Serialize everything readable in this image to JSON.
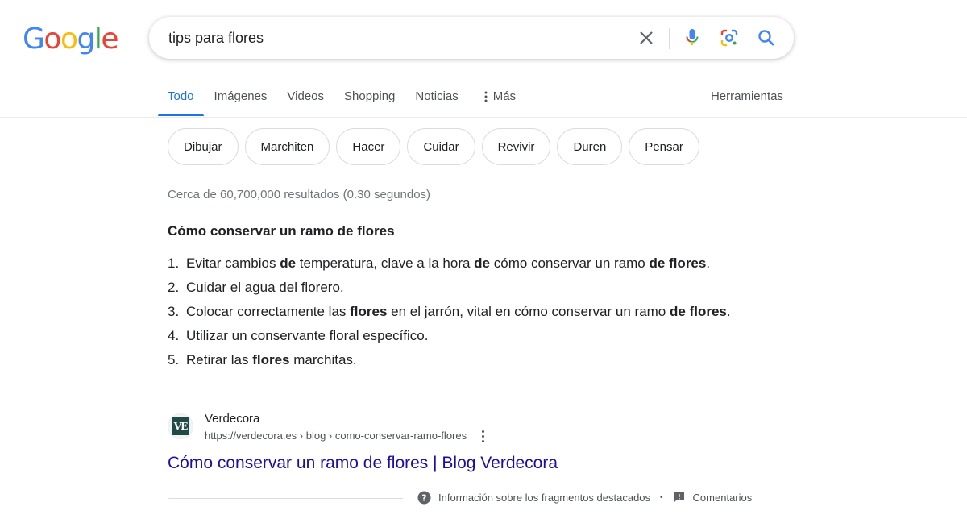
{
  "logo": {
    "text": "Google"
  },
  "search": {
    "value": "tips para flores",
    "clear_icon": "close-icon",
    "voice_icon": "microphone-icon",
    "lens_icon": "lens-icon",
    "search_icon": "search-icon"
  },
  "tabs": [
    {
      "label": "Todo",
      "active": true
    },
    {
      "label": "Imágenes"
    },
    {
      "label": "Videos"
    },
    {
      "label": "Shopping"
    },
    {
      "label": "Noticias"
    },
    {
      "label": "Más"
    }
  ],
  "tools_label": "Herramientas",
  "chips": [
    "Dibujar",
    "Marchiten",
    "Hacer",
    "Cuidar",
    "Revivir",
    "Duren",
    "Pensar"
  ],
  "stats": "Cerca de 60,700,000 resultados (0.30 segundos)",
  "snippet": {
    "title": "Cómo conservar un ramo de flores",
    "items": [
      {
        "num": "1.",
        "parts": [
          {
            "t": "Evitar cambios "
          },
          {
            "t": "de",
            "b": true
          },
          {
            "t": " temperatura, clave a la hora "
          },
          {
            "t": "de",
            "b": true
          },
          {
            "t": " cómo conservar un ramo "
          },
          {
            "t": "de flores",
            "b": true
          },
          {
            "t": "."
          }
        ]
      },
      {
        "num": "2.",
        "parts": [
          {
            "t": "Cuidar el agua del florero."
          }
        ]
      },
      {
        "num": "3.",
        "parts": [
          {
            "t": "Colocar correctamente las "
          },
          {
            "t": "flores",
            "b": true
          },
          {
            "t": " en el jarrón, vital en cómo conservar un ramo "
          },
          {
            "t": "de flores",
            "b": true
          },
          {
            "t": "."
          }
        ]
      },
      {
        "num": "4.",
        "parts": [
          {
            "t": "Utilizar un conservante floral específico."
          }
        ]
      },
      {
        "num": "5.",
        "parts": [
          {
            "t": "Retirar las "
          },
          {
            "t": "flores",
            "b": true
          },
          {
            "t": " marchitas."
          }
        ]
      }
    ]
  },
  "source": {
    "favicon_text": "VE",
    "site_name": "Verdecora",
    "url": "https://verdecora.es › blog › como-conservar-ramo-flores",
    "title": "Cómo conservar un ramo de flores | Blog Verdecora"
  },
  "footer": {
    "about_label": "Información sobre los fragmentos destacados",
    "feedback_label": "Comentarios"
  },
  "colors": {
    "link": "#1a0dab",
    "accent": "#1a73e8",
    "g_blue": "#4285F4",
    "g_red": "#EA4335",
    "g_yellow": "#FBBC05",
    "g_green": "#34A853"
  }
}
